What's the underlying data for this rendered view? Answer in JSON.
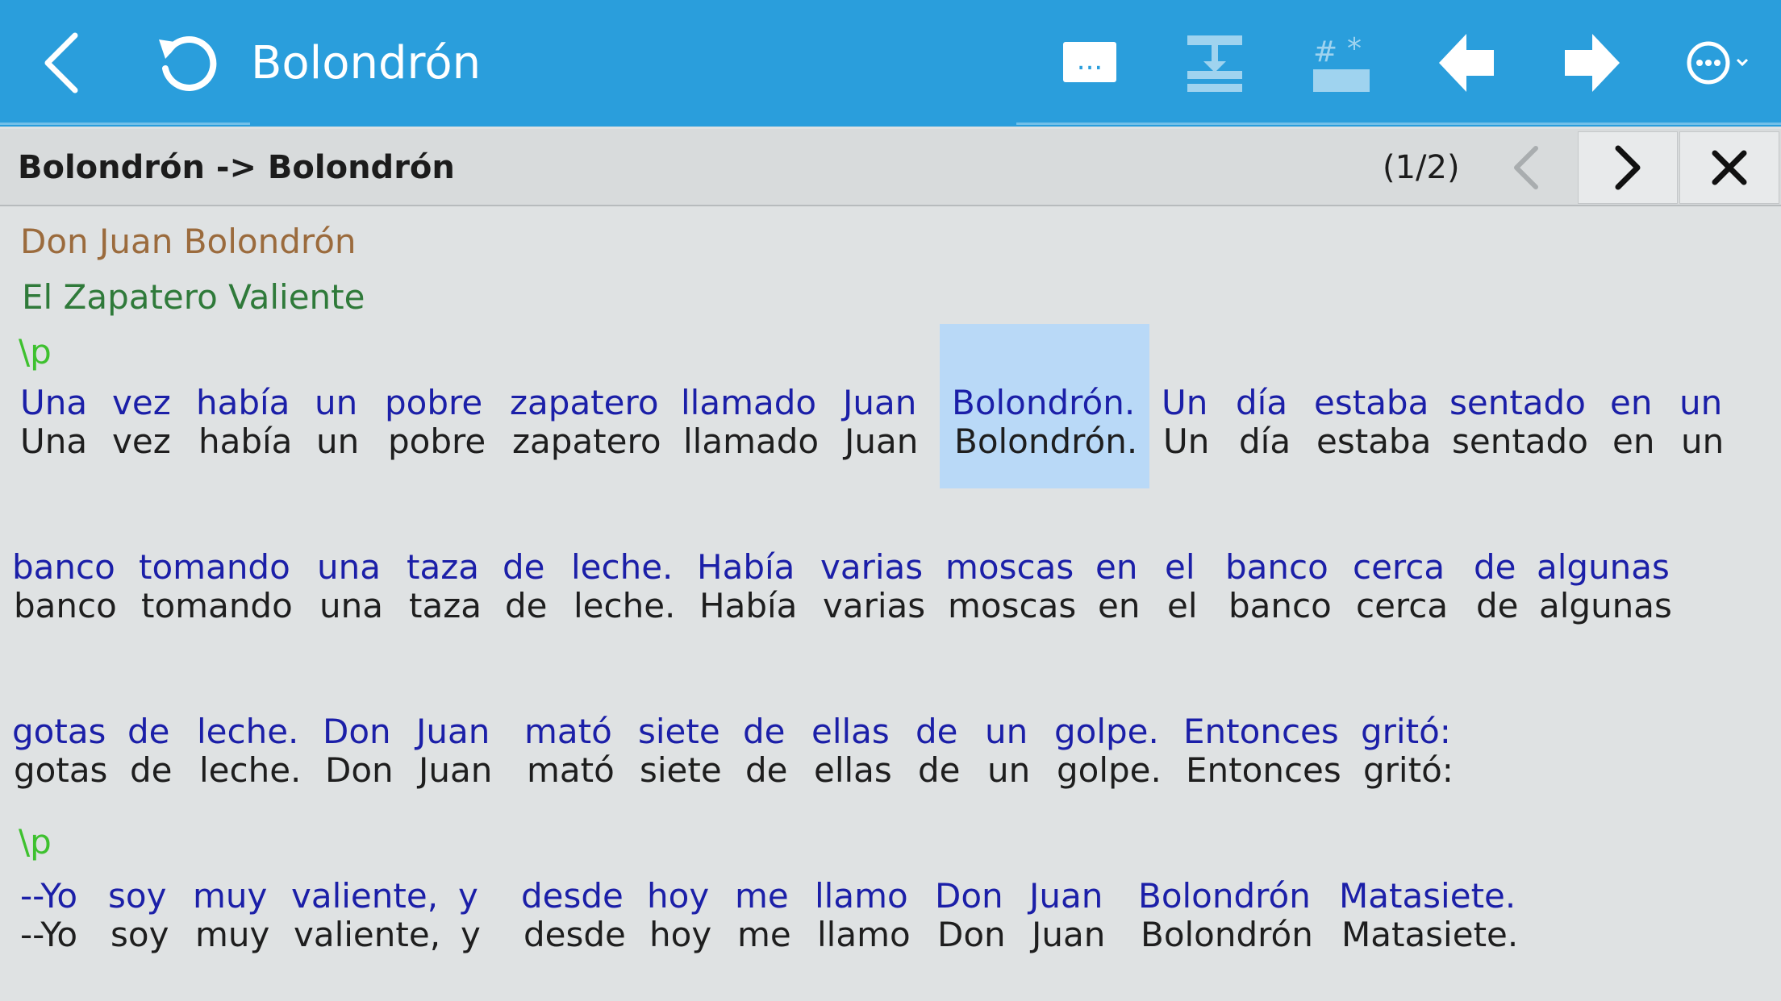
{
  "toolbar": {
    "title": "Bolondrón",
    "icons": [
      "back-chevron-icon",
      "refresh-icon",
      "ellipsis-box-icon",
      "interlinear-icon",
      "asterisk-fields-icon",
      "arrow-left-icon",
      "arrow-right-icon",
      "more-options-icon"
    ],
    "ellipsis_label": "...",
    "background": "#2a9edc"
  },
  "find_bar": {
    "query": "Bolondrón -> Bolondrón",
    "count": "(1/2)"
  },
  "document": {
    "title": "Don Juan Bolondrón",
    "subtitle": "El Zapatero Valiente",
    "paragraph_marker": "\\p",
    "lines": [
      [
        "Una",
        "vez",
        "había",
        "un",
        "pobre",
        "zapatero",
        "llamado",
        "Juan",
        "Bolondrón.",
        "Un",
        "día",
        "estaba",
        "sentado",
        "en",
        "un"
      ],
      [
        "banco",
        "tomando",
        "una",
        "taza",
        "de",
        "leche.",
        "Había",
        "varias",
        "moscas",
        "en",
        "el",
        "banco",
        "cerca",
        "de",
        "algunas"
      ],
      [
        "gotas",
        "de",
        "leche.",
        "Don",
        "Juan",
        "mató",
        "siete",
        "de",
        "ellas",
        "de",
        "un",
        "golpe.",
        "Entonces",
        "gritó:"
      ],
      [
        "--Yo",
        "soy",
        "muy",
        "valiente,",
        "y",
        "desde",
        "hoy",
        "me",
        "llamo",
        "Don",
        "Juan",
        "Bolondrón",
        "Matasiete."
      ]
    ]
  },
  "colors": {
    "gloss_text": "#1b1fa8",
    "base_text": "#1e1e1e",
    "title_text": "#9b6b3d",
    "subtitle_text": "#2f7a3a",
    "marker_text": "#3ec12f",
    "highlight": "#b9d9f7"
  }
}
